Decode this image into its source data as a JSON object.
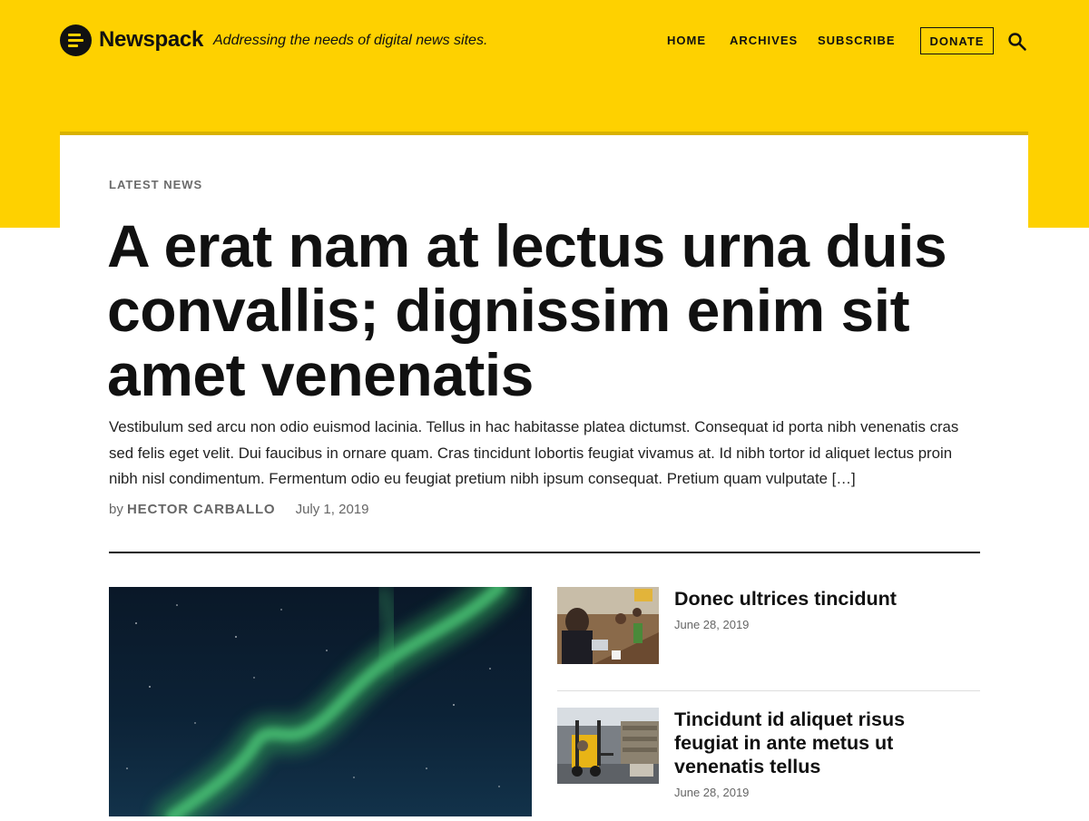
{
  "header": {
    "site_name": "Newspack",
    "tagline": "Addressing the needs of digital news sites.",
    "nav": [
      "HOME",
      "ARCHIVES",
      "SUBSCRIBE"
    ],
    "donate_label": "DONATE",
    "search_icon": "search-icon",
    "logo_icon": "newspack-logo-icon"
  },
  "colors": {
    "brand_yellow": "#FED100",
    "text": "#111111",
    "meta": "#666666"
  },
  "featured": {
    "category": "LATEST NEWS",
    "headline": "A erat nam at lectus urna duis convallis; dignissim enim sit amet venenatis",
    "excerpt": "Vestibulum sed arcu non odio euismod lacinia. Tellus in hac habitasse platea dictumst. Consequat id porta nibh venenatis cras sed felis eget velit. Dui faucibus in ornare quam. Cras tincidunt lobortis feugiat vivamus at. Id nibh tortor id aliquet lectus proin nibh nisl condimentum. Fermentum odio eu feugiat pretium nibh ipsum consequat. Pretium quam vulputate […]",
    "by_prefix": "by",
    "author": "HECTOR CARBALLO",
    "date": "July 1, 2019"
  },
  "stories": [
    {
      "title": "Donec ultrices tincidunt",
      "date": "June 28, 2019"
    },
    {
      "title": "Tincidunt id aliquet risus feugiat in ante metus ut venenatis tellus",
      "date": "June 28, 2019"
    }
  ]
}
